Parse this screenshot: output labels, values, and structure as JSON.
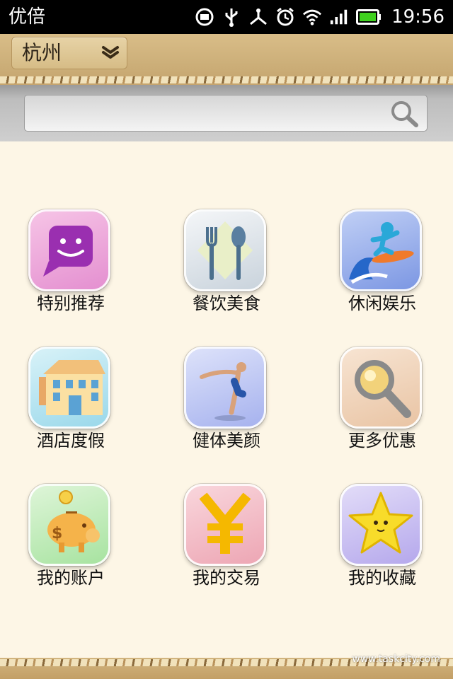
{
  "status_bar": {
    "app_name": "优倍",
    "time": "19:56",
    "icons": [
      "notification-icon",
      "usb-icon",
      "debug-icon",
      "alarm-icon",
      "wifi-icon",
      "signal-icon",
      "battery-icon"
    ]
  },
  "header": {
    "city": "杭州"
  },
  "search": {
    "value": "",
    "placeholder": ""
  },
  "grid": {
    "items": [
      {
        "label": "特别推荐",
        "icon": "smiley-chat-icon"
      },
      {
        "label": "餐饮美食",
        "icon": "fork-spoon-icon"
      },
      {
        "label": "休闲娱乐",
        "icon": "surfer-icon"
      },
      {
        "label": "酒店度假",
        "icon": "hotel-icon"
      },
      {
        "label": "健体美颜",
        "icon": "yoga-icon"
      },
      {
        "label": "更多优惠",
        "icon": "magnifier-icon"
      },
      {
        "label": "我的账户",
        "icon": "piggy-bank-icon"
      },
      {
        "label": "我的交易",
        "icon": "yuan-icon"
      },
      {
        "label": "我的收藏",
        "icon": "star-icon"
      }
    ]
  },
  "watermark": "www.taskcity.com"
}
